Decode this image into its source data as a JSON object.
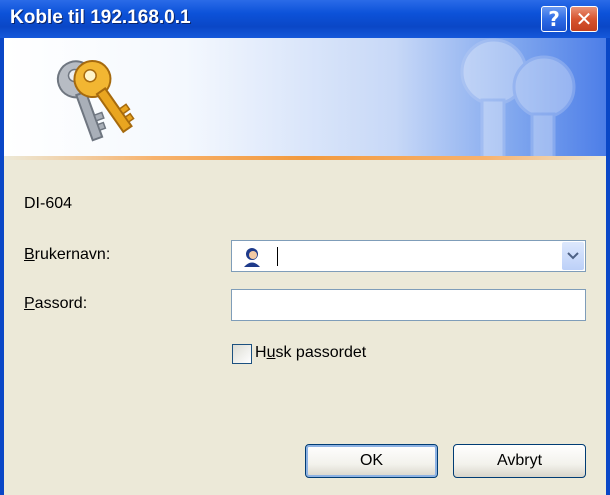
{
  "window": {
    "title": "Koble til 192.168.0.1",
    "help_label": "?",
    "close_label": "✕"
  },
  "banner": {
    "icon": "keys-icon",
    "watermark_icon": "keys-watermark-icon",
    "accent_line_color": "#F29A3E"
  },
  "content": {
    "device_name": "DI-604",
    "username": {
      "label_mnemonic": "B",
      "label_rest": "rukernavn:",
      "value": "",
      "user_icon": "user-icon",
      "dropdown_icon": "chevron-down-icon"
    },
    "password": {
      "label_mnemonic": "P",
      "label_rest": "assord:",
      "value": ""
    },
    "remember": {
      "label_before": "H",
      "label_mnemonic": "u",
      "label_after": "sk passordet",
      "checked": false
    }
  },
  "buttons": {
    "ok_label": "OK",
    "cancel_label": "Avbryt"
  },
  "colors": {
    "titlebar": "#0A47C7",
    "dialog_bg": "#ECE9D8",
    "close_button": "#D7542F"
  }
}
